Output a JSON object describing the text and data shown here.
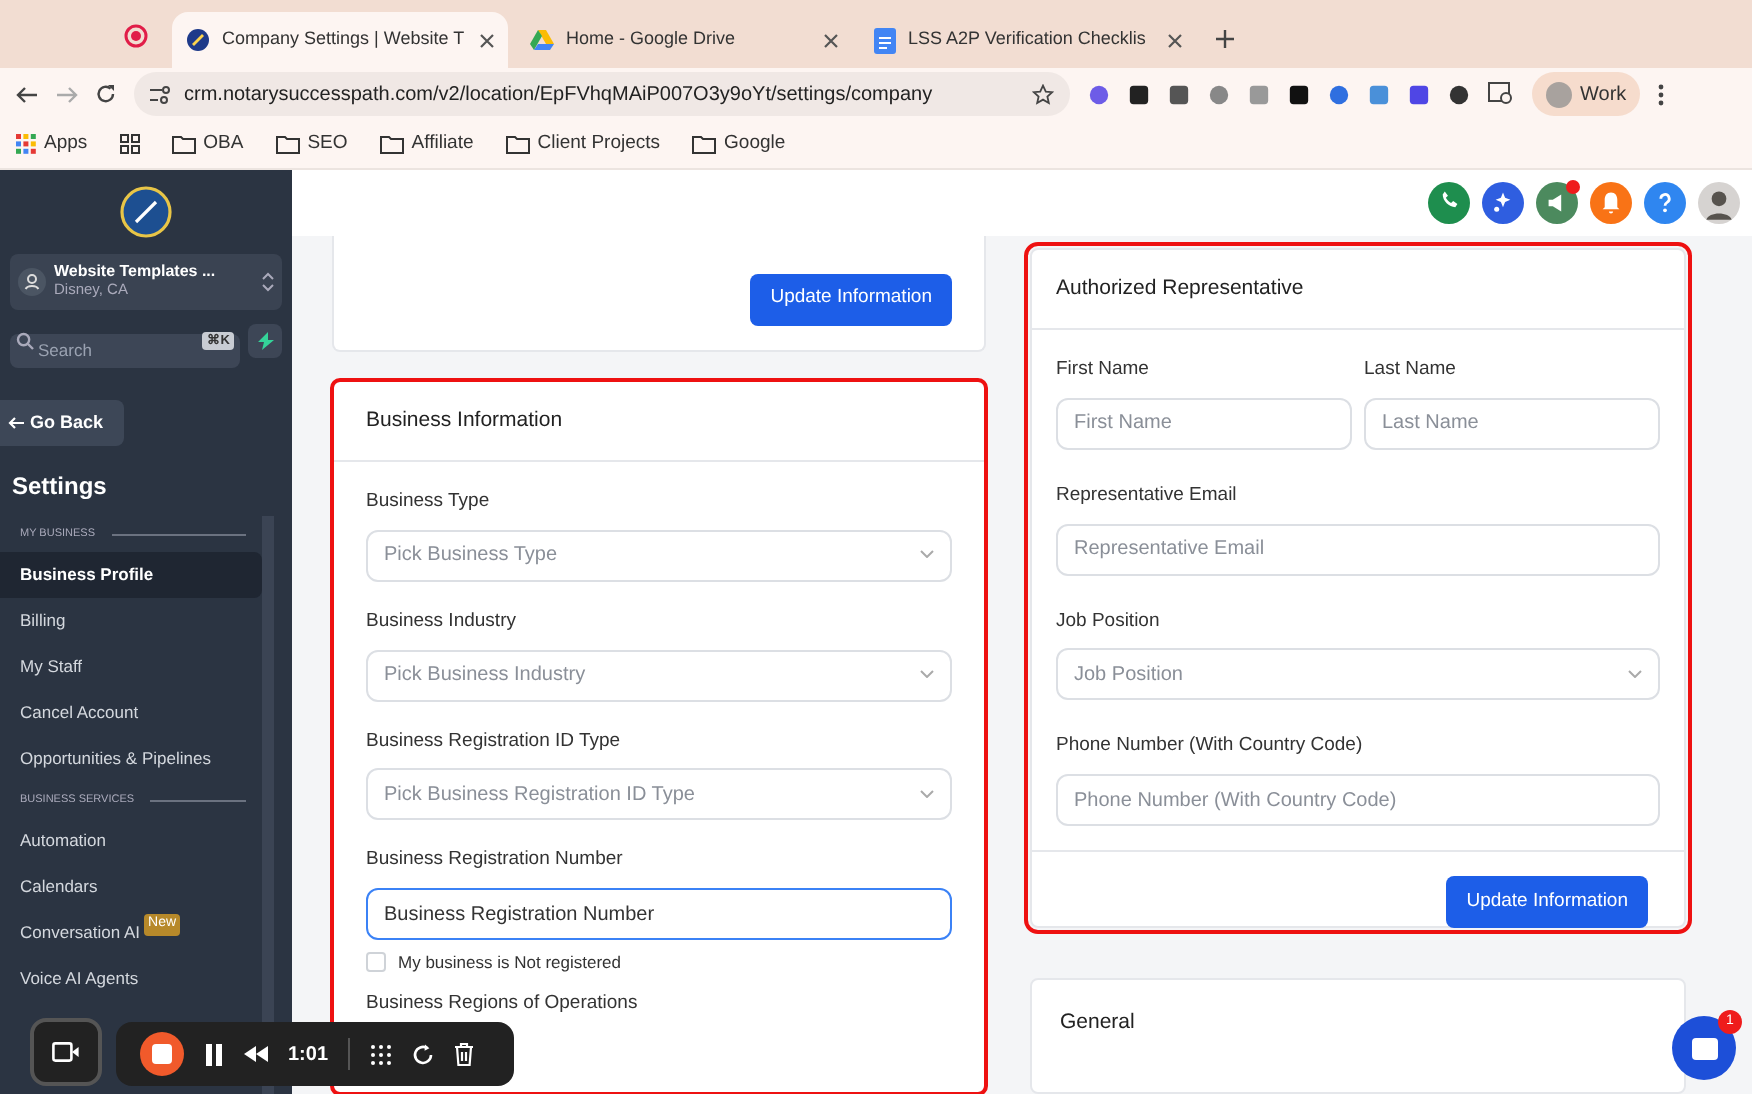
{
  "browser": {
    "tabs": [
      {
        "title": "Company Settings | Website T",
        "selected": true
      },
      {
        "title": "Home - Google Drive",
        "selected": false
      },
      {
        "title": "LSS A2P Verification Checklis",
        "selected": false
      }
    ],
    "url": "crm.notarysuccesspath.com/v2/location/EpFVhqMAiP007O3y9oYt/settings/company",
    "bookmarks": [
      {
        "label": "Apps",
        "kind": "apps"
      },
      {
        "label": "OBA",
        "kind": "folder"
      },
      {
        "label": "SEO",
        "kind": "folder"
      },
      {
        "label": "Affiliate",
        "kind": "folder"
      },
      {
        "label": "Client Projects",
        "kind": "folder"
      },
      {
        "label": "Google",
        "kind": "folder"
      }
    ],
    "profile": "Work"
  },
  "sidebar": {
    "account": {
      "name": "Website Templates ...",
      "location": "Disney, CA"
    },
    "search": {
      "placeholder": "Search",
      "shortcut": "⌘K"
    },
    "back": "Go Back",
    "title": "Settings",
    "sections": [
      {
        "heading": "MY BUSINESS",
        "items": [
          {
            "label": "Business Profile",
            "selected": true
          },
          {
            "label": "Billing",
            "selected": false
          },
          {
            "label": "My Staff",
            "selected": false
          },
          {
            "label": "Cancel Account",
            "selected": false
          },
          {
            "label": "Opportunities & Pipelines",
            "selected": false
          }
        ]
      },
      {
        "heading": "BUSINESS SERVICES",
        "items": [
          {
            "label": "Automation",
            "selected": false
          },
          {
            "label": "Calendars",
            "selected": false
          },
          {
            "label": "Conversation AI",
            "selected": false,
            "badge": "New"
          },
          {
            "label": "Voice AI Agents",
            "selected": false
          }
        ]
      }
    ]
  },
  "header_icons": [
    {
      "kind": "phone",
      "color": "#1e8e4e",
      "notification": false
    },
    {
      "kind": "sparkle",
      "color": "#2f5ee0",
      "notification": false
    },
    {
      "kind": "megaphone",
      "color": "#4c8a5e",
      "notification": true
    },
    {
      "kind": "bell",
      "color": "#f97316",
      "notification": false
    },
    {
      "kind": "help",
      "color": "#2f86f0",
      "notification": false
    },
    {
      "kind": "avatar",
      "color": "#d6d3d1",
      "notification": false
    }
  ],
  "top_card": {
    "button": "Update Information"
  },
  "business_information": {
    "title": "Business Information",
    "highlighted": true,
    "fields": [
      {
        "label": "Business Type",
        "kind": "select",
        "placeholder": "Pick Business Type",
        "focused": false
      },
      {
        "label": "Business Industry",
        "kind": "select",
        "placeholder": "Pick Business Industry",
        "focused": false
      },
      {
        "label": "Business Registration ID Type",
        "kind": "select",
        "placeholder": "Pick Business Registration ID Type",
        "focused": false
      },
      {
        "label": "Business Registration Number",
        "kind": "input",
        "placeholder": "Business Registration Number",
        "focused": true
      }
    ],
    "checkbox": {
      "label": "My business is Not registered",
      "checked": false
    },
    "next_label": "Business Regions of Operations"
  },
  "authorized_representative": {
    "title": "Authorized Representative",
    "highlighted": true,
    "rows": [
      [
        {
          "label": "First Name",
          "kind": "input",
          "placeholder": "First Name",
          "focused": false
        },
        {
          "label": "Last Name",
          "kind": "input",
          "placeholder": "Last Name",
          "focused": false
        }
      ],
      [
        {
          "label": "Representative Email",
          "kind": "input",
          "placeholder": "Representative Email",
          "focused": false
        }
      ],
      [
        {
          "label": "Job Position",
          "kind": "select",
          "placeholder": "Job Position",
          "focused": false
        }
      ],
      [
        {
          "label": "Phone Number (With Country Code)",
          "kind": "input",
          "placeholder": "Phone Number (With Country Code)",
          "focused": false
        }
      ]
    ],
    "button": "Update Information"
  },
  "general": {
    "title": "General"
  },
  "recorder": {
    "time": "1:01"
  },
  "chat": {
    "badge": "1"
  }
}
